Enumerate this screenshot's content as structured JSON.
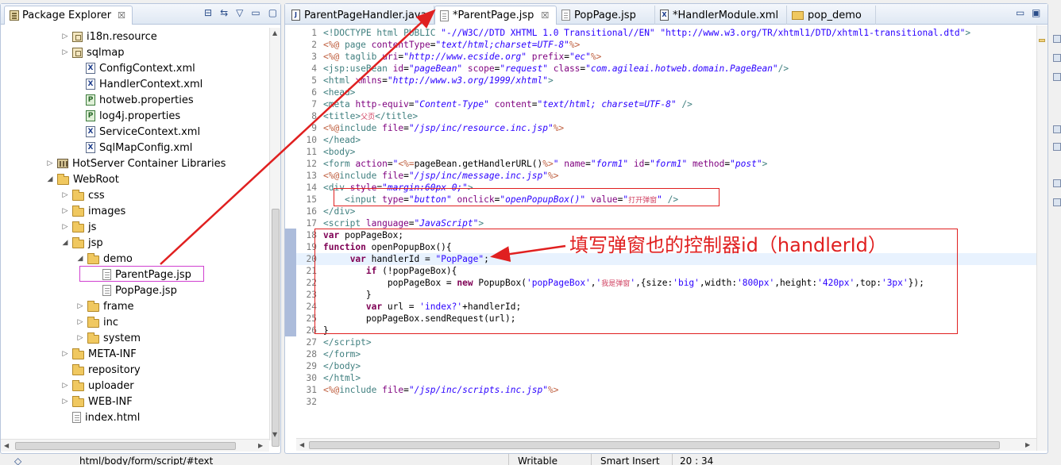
{
  "package_explorer": {
    "title": "Package Explorer",
    "close": "☒",
    "tree": [
      {
        "label": "i18n.resource",
        "icon": "package-icon",
        "twisty": "▷"
      },
      {
        "label": "sqlmap",
        "icon": "package-icon",
        "twisty": "▷"
      },
      {
        "label": "ConfigContext.xml",
        "icon": "xml-file-icon",
        "twisty": ""
      },
      {
        "label": "HandlerContext.xml",
        "icon": "xml-file-icon",
        "twisty": ""
      },
      {
        "label": "hotweb.properties",
        "icon": "properties-file-icon",
        "twisty": ""
      },
      {
        "label": "log4j.properties",
        "icon": "properties-file-icon",
        "twisty": ""
      },
      {
        "label": "ServiceContext.xml",
        "icon": "xml-file-icon",
        "twisty": ""
      },
      {
        "label": "SqlMapConfig.xml",
        "icon": "xml-file-icon",
        "twisty": ""
      },
      {
        "label": "HotServer Container Libraries",
        "icon": "library-icon",
        "twisty": "▷"
      },
      {
        "label": "WebRoot",
        "icon": "folder-icon",
        "twisty": "◢"
      },
      {
        "label": "css",
        "icon": "folder-icon",
        "twisty": "▷"
      },
      {
        "label": "images",
        "icon": "folder-icon",
        "twisty": "▷"
      },
      {
        "label": "js",
        "icon": "folder-icon",
        "twisty": "▷"
      },
      {
        "label": "jsp",
        "icon": "folder-icon",
        "twisty": "◢"
      },
      {
        "label": "demo",
        "icon": "folder-icon",
        "twisty": "◢"
      },
      {
        "label": "ParentPage.jsp",
        "icon": "jsp-file-icon",
        "twisty": ""
      },
      {
        "label": "PopPage.jsp",
        "icon": "jsp-file-icon",
        "twisty": ""
      },
      {
        "label": "frame",
        "icon": "folder-icon",
        "twisty": "▷"
      },
      {
        "label": "inc",
        "icon": "folder-icon",
        "twisty": "▷"
      },
      {
        "label": "system",
        "icon": "folder-icon",
        "twisty": "▷"
      },
      {
        "label": "META-INF",
        "icon": "folder-icon",
        "twisty": "▷"
      },
      {
        "label": "repository",
        "icon": "folder-icon",
        "twisty": ""
      },
      {
        "label": "uploader",
        "icon": "folder-icon",
        "twisty": "▷"
      },
      {
        "label": "WEB-INF",
        "icon": "folder-icon",
        "twisty": "▷"
      },
      {
        "label": "index.html",
        "icon": "html-file-icon",
        "twisty": ""
      }
    ]
  },
  "editor_tabs": [
    {
      "label": "ParentPageHandler.java",
      "icon": "java-file-icon",
      "active": false
    },
    {
      "label": "*ParentPage.jsp",
      "icon": "jsp-file-icon",
      "active": true,
      "close": "☒"
    },
    {
      "label": "PopPage.jsp",
      "icon": "jsp-file-icon",
      "active": false
    },
    {
      "label": "*HandlerModule.xml",
      "icon": "xml-file-icon",
      "active": false
    },
    {
      "label": "pop_demo",
      "icon": "project-icon",
      "active": false
    }
  ],
  "editor_controls": {
    "minimize": "▭",
    "maximize": "▣"
  },
  "annotation": "填写弹窗也的控制器id（handlerId）",
  "status_bar": {
    "path": "html/body/form/script/#text",
    "writable": "Writable",
    "insert_mode": "Smart Insert",
    "position": "20 : 34"
  },
  "colors": {
    "annotation_red": "#e02020",
    "selection_magenta": "#d040d0",
    "current_line": "#e8f2fe"
  }
}
